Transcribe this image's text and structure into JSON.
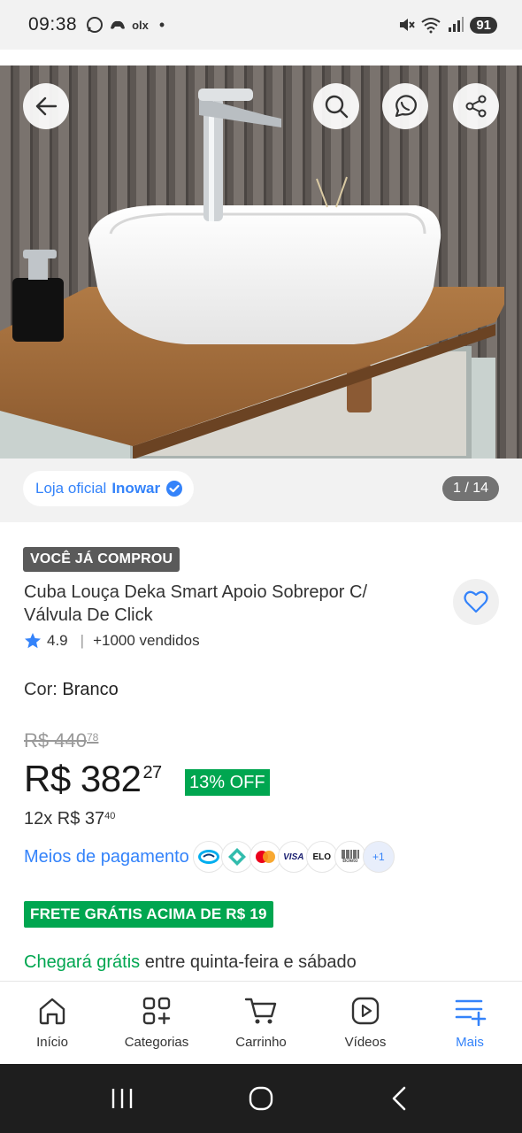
{
  "status_bar": {
    "time": "09:38",
    "left_icons": [
      "whatsapp-icon",
      "game-icon",
      "olx-icon",
      "dot-icon"
    ],
    "olx_label": "olx",
    "battery": "91"
  },
  "hero": {
    "buttons": [
      "back-icon",
      "search-icon",
      "whatsapp-icon",
      "share-icon"
    ]
  },
  "store": {
    "prefix": "Loja oficial",
    "name": "Inowar",
    "counter": "1 / 14"
  },
  "product": {
    "badge": "VOCÊ JÁ COMPROU",
    "title": "Cuba Louça Deka Smart Apoio Sobrepor C/ Válvula De Click",
    "rating": "4.9",
    "sold": "+1000 vendidos",
    "color_label": "Cor:",
    "color_value": "Branco",
    "old_price_main": "R$ 440",
    "old_price_cents": "78",
    "price_main": "R$ 382",
    "price_cents": "27",
    "discount": "13% OFF",
    "installments_main": "12x R$ 37",
    "installments_cents": "40",
    "payment_link": "Meios de pagamento",
    "payment_methods": [
      "mercadopago-icon",
      "pix-icon",
      "mastercard-icon",
      "visa-icon",
      "elo-icon",
      "boleto-icon"
    ],
    "payment_more": "+1",
    "visa_text": "VISA",
    "elo_text": "ELO",
    "boleto_text": "Boleto",
    "shipping_badge": "FRETE GRÁTIS ACIMA DE R$ 19",
    "arrival_highlight": "Chegará grátis",
    "arrival_rest": " entre quinta-feira e sábado"
  },
  "bottom_nav": [
    {
      "label": "Início"
    },
    {
      "label": "Categorias"
    },
    {
      "label": "Carrinho"
    },
    {
      "label": "Vídeos"
    },
    {
      "label": "Mais"
    }
  ],
  "colors": {
    "accent_blue": "#3483fa",
    "green": "#00a650",
    "badge_gray": "#5a5a5a"
  }
}
